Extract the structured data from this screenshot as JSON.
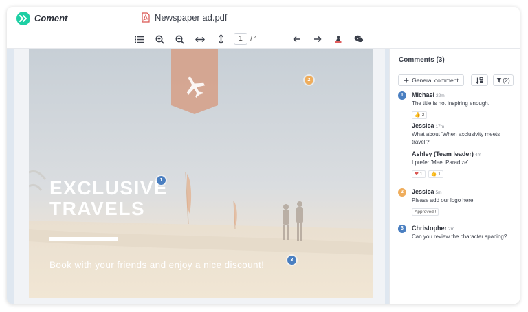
{
  "app": {
    "name": "Coment",
    "brand_color": "#1ecfa4"
  },
  "document": {
    "title": "Newspaper ad.pdf",
    "icon": "pdf-file-icon"
  },
  "toolbar": {
    "tools": [
      "list-icon",
      "zoom-in-icon",
      "zoom-out-icon",
      "fit-width-icon",
      "fit-height-icon",
      "arrow-left-icon",
      "arrow-right-icon",
      "stamp-icon",
      "comments-icon"
    ],
    "page_current": "1",
    "page_total": "/ 1"
  },
  "ad": {
    "title_line1": "EXCLUSIVE",
    "title_line2": "TRAVELS",
    "tagline": "Book with your friends and enjoy a nice discount!",
    "icon": "airplane-icon"
  },
  "pins": [
    {
      "number": "1",
      "color": "#4a7fc1"
    },
    {
      "number": "2",
      "color": "#efad5c"
    },
    {
      "number": "3",
      "color": "#4a7fc1"
    }
  ],
  "sidebar": {
    "title": "Comments (3)",
    "general_comment_label": "General comment",
    "sort_icon": "sort-icon",
    "filter_label": "(2)",
    "filter_icon": "filter-icon"
  },
  "threads": [
    {
      "number": "1",
      "color": "#4a7fc1",
      "comments": [
        {
          "author": "Michael",
          "time": "22m",
          "text": "The title is not inspiring enough.",
          "reactions": [
            {
              "emoji": "👍",
              "count": "2"
            }
          ]
        },
        {
          "author": "Jessica",
          "time": "17m",
          "text": "What about 'When exclusivity meets travel'?",
          "reactions": []
        },
        {
          "author": "Ashley (Team leader)",
          "time": "4m",
          "text": "I prefer 'Meet Paradize'.",
          "reactions": [
            {
              "emoji": "❤",
              "count": "1"
            },
            {
              "emoji": "👍",
              "count": "1"
            }
          ]
        }
      ]
    },
    {
      "number": "2",
      "color": "#efad5c",
      "comments": [
        {
          "author": "Jessica",
          "time": "5m",
          "text": "Please add our logo here.",
          "status": "Approved !"
        }
      ]
    },
    {
      "number": "3",
      "color": "#4a7fc1",
      "comments": [
        {
          "author": "Christopher",
          "time": "2m",
          "text": "Can you review the character spacing?"
        }
      ]
    }
  ]
}
